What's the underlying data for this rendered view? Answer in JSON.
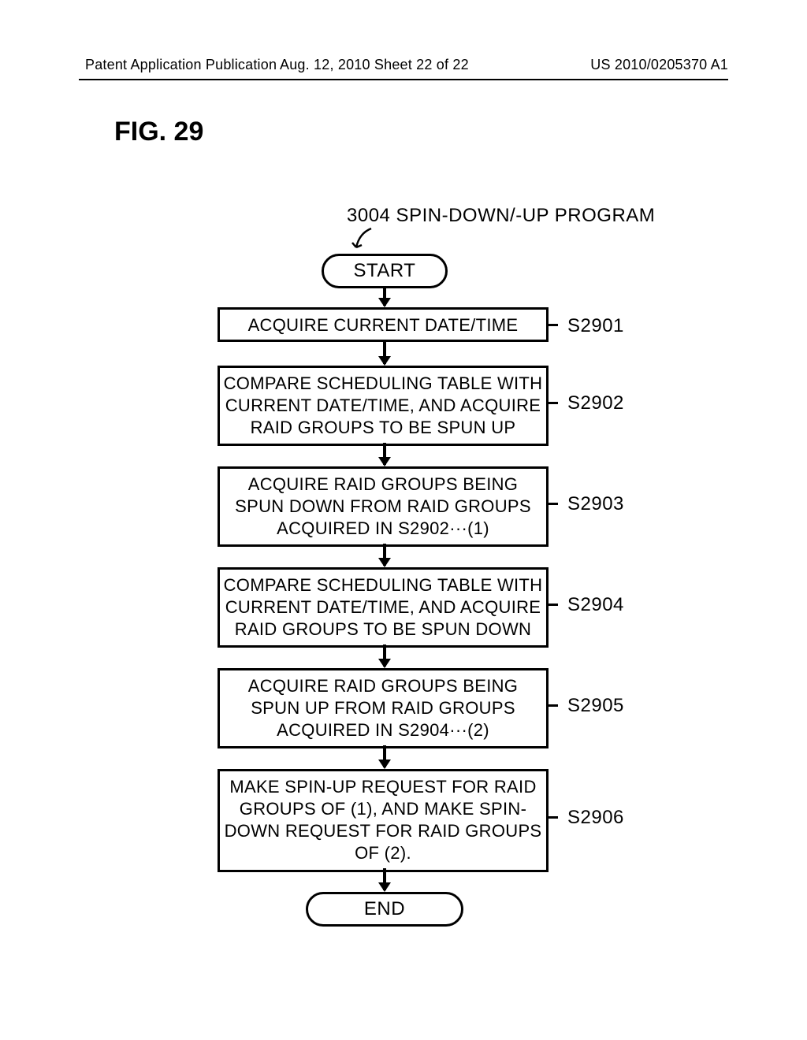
{
  "header": {
    "left": "Patent Application Publication",
    "mid": "Aug. 12, 2010  Sheet 22 of 22",
    "right": "US 2010/0205370 A1"
  },
  "figure_label": "FIG. 29",
  "caption": "3004 SPIN-DOWN/-UP PROGRAM",
  "start": "START",
  "end": "END",
  "steps": [
    {
      "label": "S2901",
      "text": "ACQUIRE CURRENT DATE/TIME"
    },
    {
      "label": "S2902",
      "text": "COMPARE SCHEDULING TABLE WITH CURRENT DATE/TIME, AND ACQUIRE RAID GROUPS TO BE SPUN UP"
    },
    {
      "label": "S2903",
      "text": "ACQUIRE RAID GROUPS BEING SPUN DOWN FROM RAID GROUPS ACQUIRED IN S2902···(1)"
    },
    {
      "label": "S2904",
      "text": "COMPARE SCHEDULING TABLE WITH CURRENT DATE/TIME, AND ACQUIRE RAID GROUPS TO BE SPUN DOWN"
    },
    {
      "label": "S2905",
      "text": "ACQUIRE RAID GROUPS BEING SPUN UP FROM RAID GROUPS ACQUIRED IN S2904···(2)"
    },
    {
      "label": "S2906",
      "text": "MAKE SPIN-UP REQUEST FOR RAID GROUPS OF (1), AND MAKE SPIN-DOWN REQUEST FOR RAID GROUPS OF (2)."
    }
  ]
}
